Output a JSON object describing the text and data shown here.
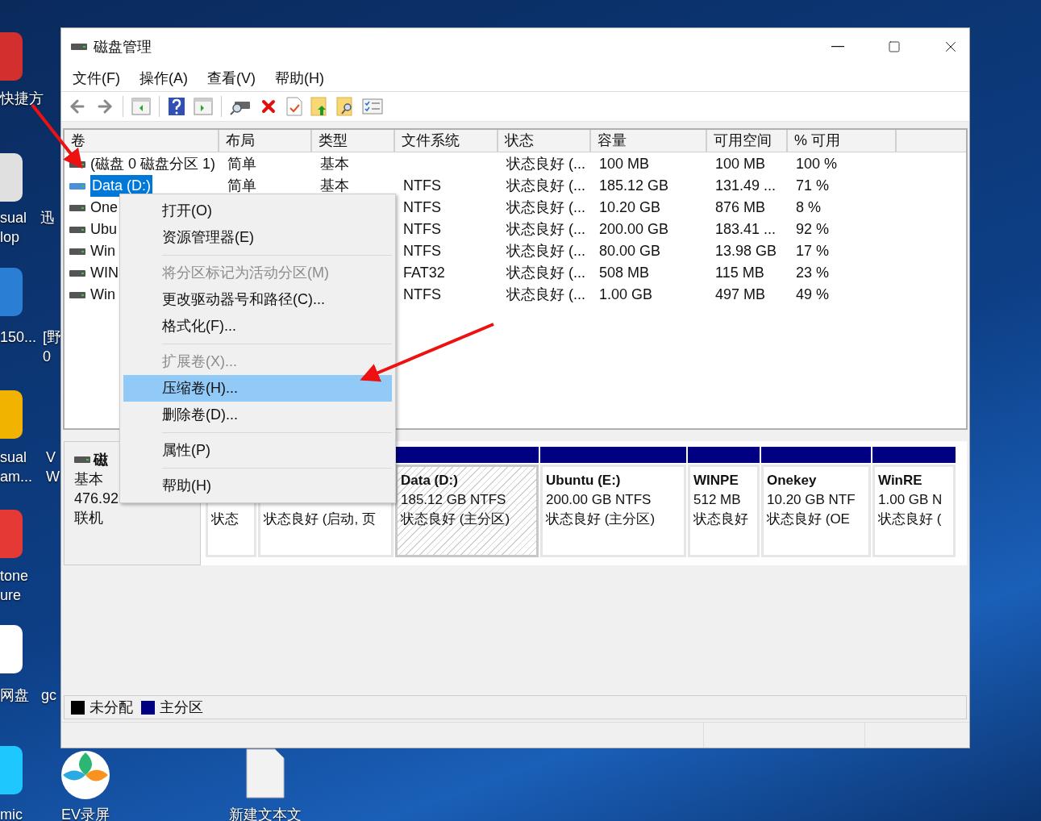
{
  "desktop": {
    "icons": [
      {
        "lines": [
          "快捷方"
        ]
      },
      {
        "lines": [
          "sual",
          "lop"
        ]
      },
      {
        "lines": [
          "150..."
        ]
      },
      {
        "lines": [
          "sual",
          "am..."
        ]
      },
      {
        "lines": [
          "tone",
          "ure"
        ]
      },
      {
        "lines": [
          "网盘"
        ]
      },
      {
        "lines": [
          "mic"
        ]
      },
      {
        "lines": [
          "迅"
        ]
      },
      {
        "lines": [
          "[野",
          "0"
        ]
      },
      {
        "lines": [
          "V",
          "W"
        ]
      },
      {
        "lines": [
          "gc"
        ]
      },
      {
        "lines": [
          "EV录屏"
        ]
      },
      {
        "lines": [
          "新建文本文"
        ]
      }
    ]
  },
  "window": {
    "title": "磁盘管理"
  },
  "menu": [
    "文件(F)",
    "操作(A)",
    "查看(V)",
    "帮助(H)"
  ],
  "table": {
    "columns": [
      "卷",
      "布局",
      "类型",
      "文件系统",
      "状态",
      "容量",
      "可用空间",
      "% 可用"
    ],
    "rows": [
      {
        "volume": "(磁盘 0 磁盘分区 1)",
        "layout": "简单",
        "type": "基本",
        "status": "状态良好 (...",
        "capacity": "100 MB",
        "free": "100 MB",
        "percent": "100 %",
        "selected": false
      },
      {
        "volume": "Data (D:)",
        "layout": "简单",
        "type": "基本",
        "fs": "NTFS",
        "status": "状态良好 (...",
        "capacity": "185.12 GB",
        "free": "131.49 ...",
        "percent": "71 %",
        "selected": true
      },
      {
        "volume": "One",
        "fs": "NTFS",
        "status": "状态良好 (...",
        "capacity": "10.20 GB",
        "free": "876 MB",
        "percent": "8 %",
        "selected": false
      },
      {
        "volume": "Ubu",
        "fs": "NTFS",
        "status": "状态良好 (...",
        "capacity": "200.00 GB",
        "free": "183.41 ...",
        "percent": "92 %",
        "selected": false
      },
      {
        "volume": "Win",
        "fs": "NTFS",
        "status": "状态良好 (...",
        "capacity": "80.00 GB",
        "free": "13.98 GB",
        "percent": "17 %",
        "selected": false
      },
      {
        "volume": "WIN",
        "fs": "FAT32",
        "status": "状态良好 (...",
        "capacity": "508 MB",
        "free": "115 MB",
        "percent": "23 %",
        "selected": false
      },
      {
        "volume": "Win",
        "fs": "NTFS",
        "status": "状态良好 (...",
        "capacity": "1.00 GB",
        "free": "497 MB",
        "percent": "49 %",
        "selected": false
      }
    ]
  },
  "context_menu": [
    {
      "kind": "item",
      "label": "打开(O)",
      "disabled": false,
      "selected": false
    },
    {
      "kind": "item",
      "label": "资源管理器(E)",
      "disabled": false,
      "selected": false
    },
    {
      "kind": "separator"
    },
    {
      "kind": "item",
      "label": "将分区标记为活动分区(M)",
      "disabled": true,
      "selected": false
    },
    {
      "kind": "item",
      "label": "更改驱动器号和路径(C)...",
      "disabled": false,
      "selected": false
    },
    {
      "kind": "item",
      "label": "格式化(F)...",
      "disabled": false,
      "selected": false
    },
    {
      "kind": "separator"
    },
    {
      "kind": "item",
      "label": "扩展卷(X)...",
      "disabled": true,
      "selected": false
    },
    {
      "kind": "item",
      "label": "压缩卷(H)...",
      "disabled": false,
      "selected": true
    },
    {
      "kind": "item",
      "label": "删除卷(D)...",
      "disabled": false,
      "selected": false
    },
    {
      "kind": "separator"
    },
    {
      "kind": "item",
      "label": "属性(P)",
      "disabled": false,
      "selected": false
    },
    {
      "kind": "separator"
    },
    {
      "kind": "item",
      "label": "帮助(H)",
      "disabled": false,
      "selected": false
    }
  ],
  "disk": {
    "name": "磁",
    "type": "基本",
    "size": "476.92",
    "state": "联机",
    "partitions": [
      {
        "status": "状态",
        "selected": false
      },
      {
        "status": "状态良好 (启动, 页",
        "selected": false
      },
      {
        "name": "Data  (D:)",
        "size": "185.12 GB NTFS",
        "status": "状态良好 (主分区)",
        "selected": true
      },
      {
        "name": "Ubuntu  (E:)",
        "size": "200.00 GB NTFS",
        "status": "状态良好 (主分区)",
        "selected": false
      },
      {
        "name": "WINPE",
        "size": "512 MB",
        "status": "状态良好",
        "selected": false
      },
      {
        "name": "Onekey",
        "size": "10.20 GB NTF",
        "status": "状态良好 (OE",
        "selected": false
      },
      {
        "name": "WinRE",
        "size": "1.00 GB N",
        "status": "状态良好 (",
        "selected": false
      }
    ]
  },
  "legend": [
    {
      "label": "未分配",
      "color": "#000000"
    },
    {
      "label": "主分区",
      "color": "#000080"
    }
  ]
}
